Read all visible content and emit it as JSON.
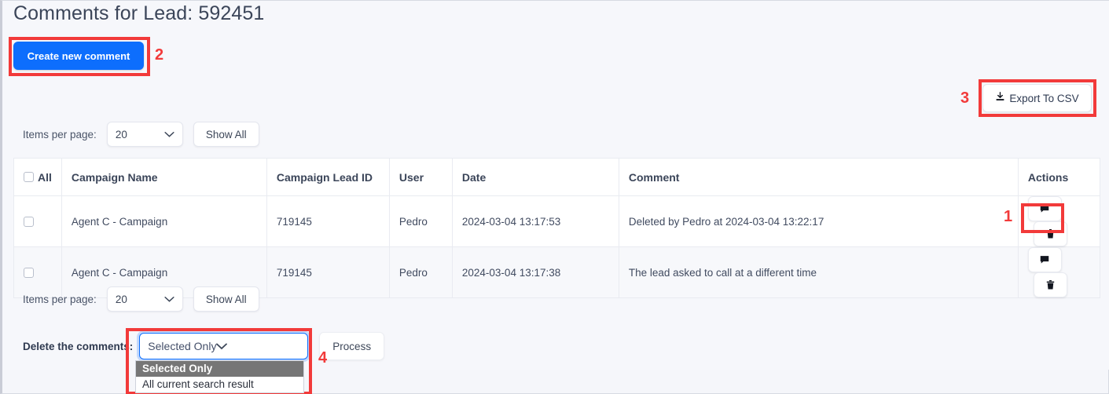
{
  "header": {
    "title": "Comments for Lead: 592451"
  },
  "toolbar": {
    "create_label": "Create new comment",
    "export_label": "Export To CSV",
    "export_icon": "download-icon"
  },
  "pager_top": {
    "label": "Items per page:",
    "value": "20",
    "show_all_label": "Show All",
    "chevron_icon": "chevron-down-icon"
  },
  "pager_bottom": {
    "label": "Items per page:",
    "value": "20",
    "show_all_label": "Show All",
    "chevron_icon": "chevron-down-icon"
  },
  "table": {
    "columns": {
      "all": "All",
      "campaign_name": "Campaign Name",
      "campaign_lead_id": "Campaign Lead ID",
      "user": "User",
      "date": "Date",
      "comment": "Comment",
      "actions": "Actions"
    },
    "rows": [
      {
        "campaign_name": "Agent C - Campaign",
        "campaign_lead_id": "719145",
        "user": "Pedro",
        "date": "2024-03-04 13:17:53",
        "comment": "Deleted by Pedro at 2024-03-04 13:22:17",
        "comment_icon": "comment-icon",
        "delete_icon": "trash-icon"
      },
      {
        "campaign_name": "Agent C - Campaign",
        "campaign_lead_id": "719145",
        "user": "Pedro",
        "date": "2024-03-04 13:17:38",
        "comment": "The lead asked to call at a different time",
        "comment_icon": "comment-icon",
        "delete_icon": "trash-icon"
      }
    ]
  },
  "delete_section": {
    "label": "Delete the comments:",
    "selected_value": "Selected Only",
    "options": [
      "Selected Only",
      "All current search result"
    ],
    "process_label": "Process",
    "chevron_icon": "chevron-down-icon"
  },
  "annotations": {
    "one": "1",
    "two": "2",
    "three": "3",
    "four": "4",
    "color": "#f23a3a"
  }
}
